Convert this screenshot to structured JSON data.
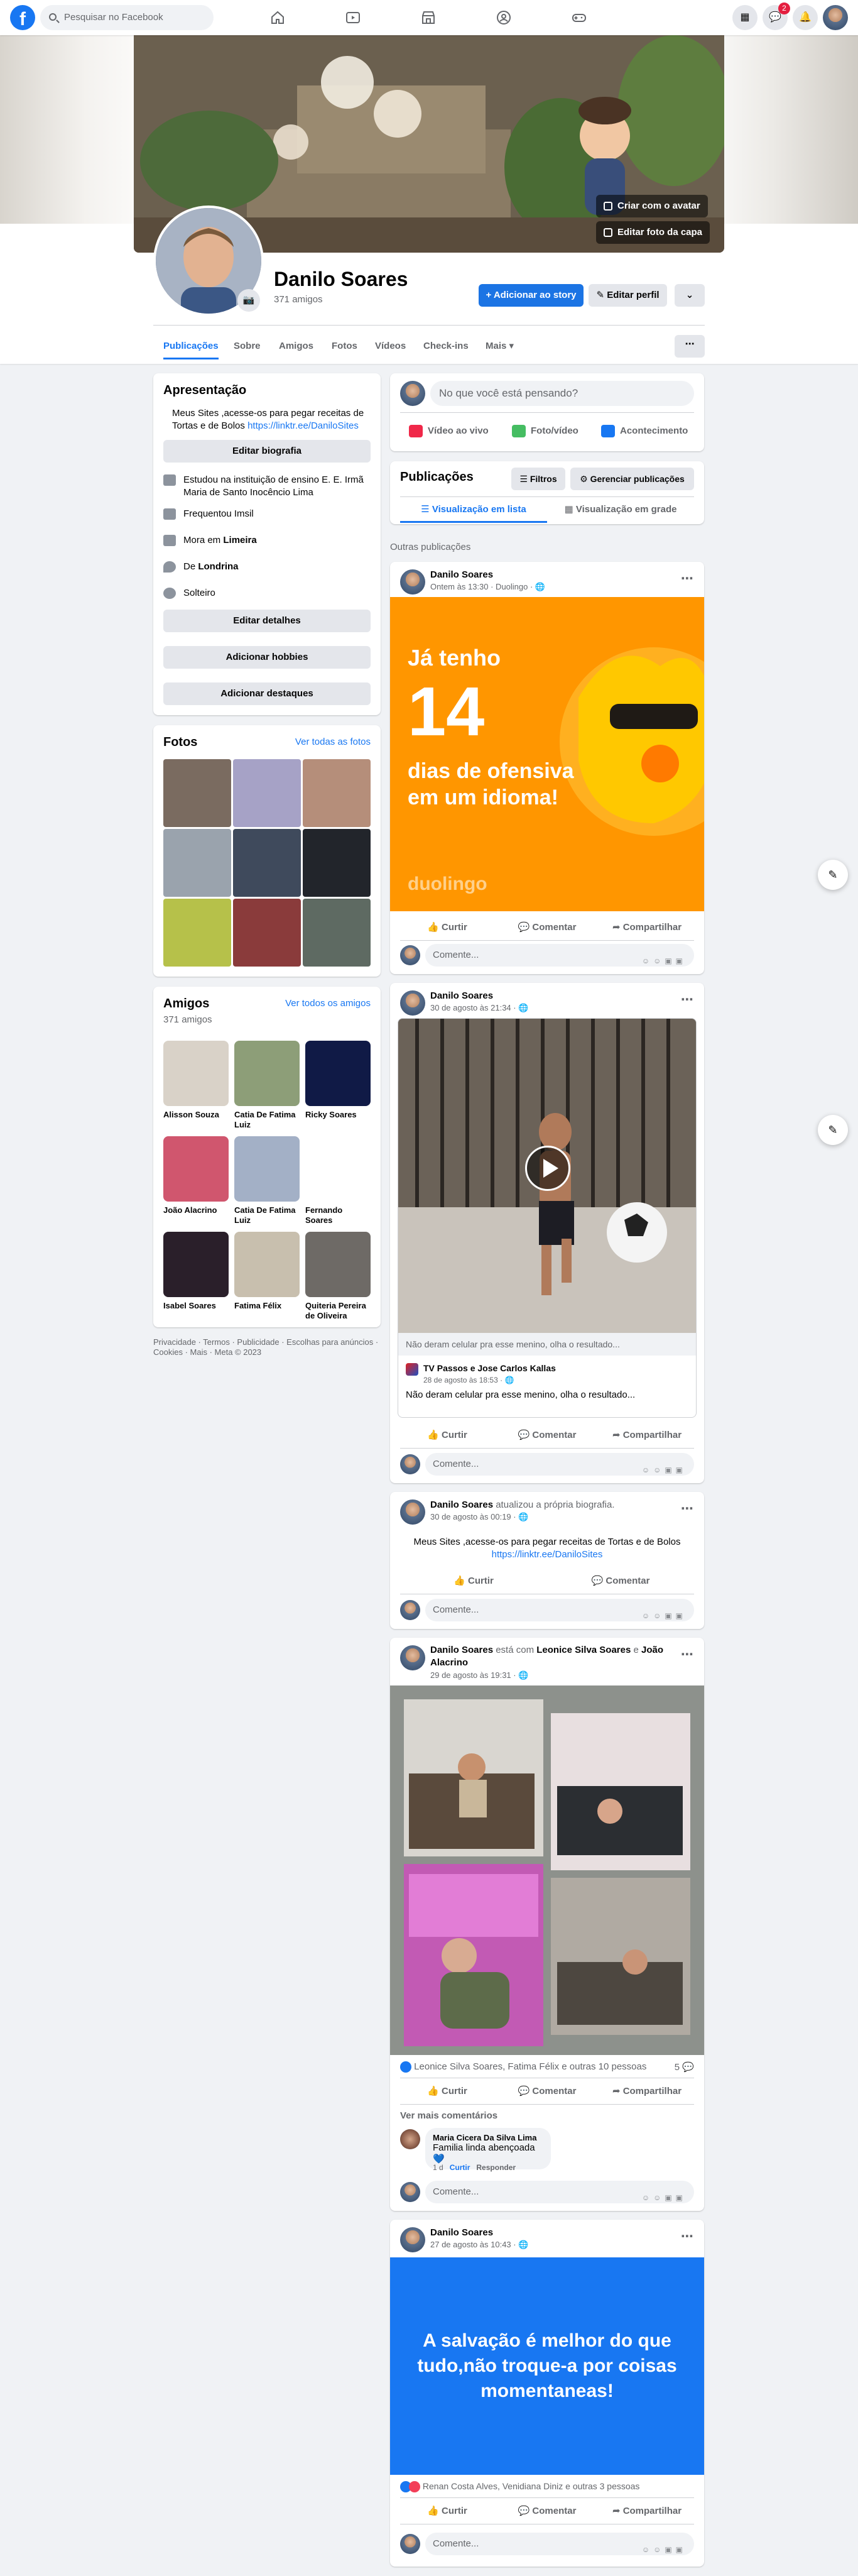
{
  "topbar": {
    "logo": "f",
    "search_placeholder": "Pesquisar no Facebook",
    "nav_icons": [
      "home-icon",
      "video-icon",
      "marketplace-icon",
      "groups-icon",
      "gaming-icon"
    ],
    "right_icons": [
      "menu-grid-icon",
      "messenger-icon",
      "notifications-icon",
      "account-avatar"
    ],
    "messenger_badge": "2"
  },
  "cover": {
    "create_avatar": "Criar com o avatar",
    "edit_cover": "Editar foto da capa"
  },
  "profile": {
    "name": "Danilo Soares",
    "friends_count": "371 amigos",
    "add_story": "Adicionar ao story",
    "edit_profile": "Editar perfil"
  },
  "tabs": [
    "Publicações",
    "Sobre",
    "Amigos",
    "Fotos",
    "Vídeos",
    "Check-ins",
    "Mais"
  ],
  "intro": {
    "title": "Apresentação",
    "bio_text": "Meus Sites ,acesse-os para pegar receitas de Tortas e de Bolos",
    "bio_link": "https://linktr.ee/DaniloSites",
    "edit_bio": "Editar biografia",
    "items": [
      {
        "icon": "graduation-cap-icon",
        "text": "Estudou na instituição de ensino E. E. Irmã Maria de Santo Inocêncio Lima"
      },
      {
        "icon": "graduation-cap-icon",
        "text": "Frequentou Imsil"
      },
      {
        "icon": "house-icon",
        "text": "Mora em",
        "bold": "Limeira"
      },
      {
        "icon": "location-pin-icon",
        "text": "De",
        "bold": "Londrina"
      },
      {
        "icon": "heart-icon",
        "text": "Solteiro"
      }
    ],
    "edit_details": "Editar detalhes",
    "add_hobbies": "Adicionar hobbies",
    "add_highlights": "Adicionar destaques"
  },
  "photos": {
    "title": "Fotos",
    "see_all": "Ver todas as fotos"
  },
  "friends": {
    "title": "Amigos",
    "count": "371 amigos",
    "see_all": "Ver todos os amigos",
    "list": [
      {
        "name": "Alisson Souza",
        "color": "#d9d2c8"
      },
      {
        "name": "Catia De Fatima Luiz",
        "color": "#8d9e78"
      },
      {
        "name": "Ricky Soares",
        "color": "#101a46"
      },
      {
        "name": "João Alacrino",
        "color": "#d0566e"
      },
      {
        "name": "Catia De Fatima Luiz",
        "color": "#a3b0c6"
      },
      {
        "name": "Fernando Soares",
        "color": "#ffffff"
      },
      {
        "name": "Isabel Soares",
        "color": "#2a1f2a"
      },
      {
        "name": "Fatima Félix",
        "color": "#c8bfae"
      },
      {
        "name": "Quiteria Pereira de Oliveira",
        "color": "#6e6a66"
      }
    ]
  },
  "footer": "Privacidade · Termos · Publicidade · Escolhas para anúncios · Cookies · Mais · Meta © 2023",
  "composer": {
    "placeholder": "No que você está pensando?",
    "live": "Vídeo ao vivo",
    "photo": "Foto/vídeo",
    "event": "Acontecimento"
  },
  "publications": {
    "title": "Publicações",
    "filters": "Filtros",
    "manage": "Gerenciar publicações",
    "list_view": "Visualização em lista",
    "grid_view": "Visualização em grade",
    "other_posts": "Outras publicações"
  },
  "actions": {
    "like": "Curtir",
    "comment": "Comentar",
    "share": "Compartilhar",
    "comment_placeholder": "Comente..."
  },
  "posts": {
    "p1": {
      "author": "Danilo Soares",
      "meta": "Ontem às 13:30 · Duolingo · ",
      "line1": "Já tenho",
      "number": "14",
      "line2": "dias de ofensiva",
      "line3": "em um idioma!",
      "brand": "duolingo"
    },
    "p2": {
      "author": "Danilo Soares",
      "meta": "30 de agosto às 21:34 · ",
      "caption": "Não deram celular pra esse menino, olha o resultado...",
      "shared_from": "TV Passos e Jose Carlos Kallas",
      "shared_meta": "28 de agosto às 18:53 · ",
      "shared_text": "Não deram celular pra esse menino, olha o resultado..."
    },
    "p3": {
      "author": "Danilo Soares",
      "action": "atualizou a própria biografia.",
      "meta": "30 de agosto às 00:19 · ",
      "text": "Meus Sites ,acesse-os para pegar receitas de Tortas e de Bolos",
      "link": "https://linktr.ee/DaniloSites"
    },
    "p4": {
      "author": "Danilo Soares",
      "with": "está com",
      "tag1": "Leonice Silva Soares",
      "and": "e",
      "tag2": "João Alacrino",
      "meta": "29 de agosto às 19:31 · ",
      "reactions": "Leonice Silva Soares, Fatima Félix e outras 10 pessoas",
      "comment_count": "5",
      "more_comments": "Ver mais comentários",
      "commenter": "Maria Cicera Da Silva Lima",
      "comment_text": "Familia linda abençoada",
      "comment_time": "1 d",
      "comment_like": "Curtir",
      "comment_reply": "Responder"
    },
    "p5": {
      "author": "Danilo Soares",
      "meta": "27 de agosto às 10:43 · ",
      "text": "A salvação é melhor do que tudo,não troque-a por coisas momentaneas!",
      "reactions": "Renan Costa Alves, Venidiana Diniz e outras 3 pessoas",
      "bg_color": "#1877f2"
    }
  },
  "colors": {
    "brand": "#1877f2",
    "duolingo_orange": "#ff9600"
  }
}
